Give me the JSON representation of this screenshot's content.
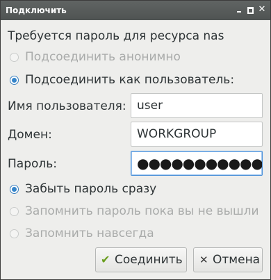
{
  "window": {
    "title": "Подключить",
    "minimize_icon": "minimize-icon",
    "maximize_icon": "maximize-icon",
    "close_icon": "close-icon"
  },
  "prompt": "Требуется пароль для ресурса nas",
  "connect_mode": {
    "anonymous_label": "Подсоединить анонимно",
    "user_label": "Подсоединить как пользователь:",
    "selected": "user"
  },
  "form": {
    "username_label": "Имя пользователя:",
    "username_value": "user",
    "domain_label": "Домен:",
    "domain_value": "WORKGROUP",
    "password_label": "Пароль:",
    "password_masked": "●●●●●●●●●●●"
  },
  "remember": {
    "forget_label": "Забыть пароль сразу",
    "session_label": "Запомнить пароль пока вы не вышли",
    "forever_label": "Запомнить навсегда",
    "selected": "forget"
  },
  "buttons": {
    "connect_label": "Соединить",
    "connect_icon": "checkmark-icon",
    "cancel_label": "Отмена",
    "cancel_icon": "x-icon"
  },
  "colors": {
    "accent": "#3584c9",
    "titlebar": "#56595a",
    "dialog_bg": "#eeeeec",
    "disabled_text": "#a9abaa"
  }
}
